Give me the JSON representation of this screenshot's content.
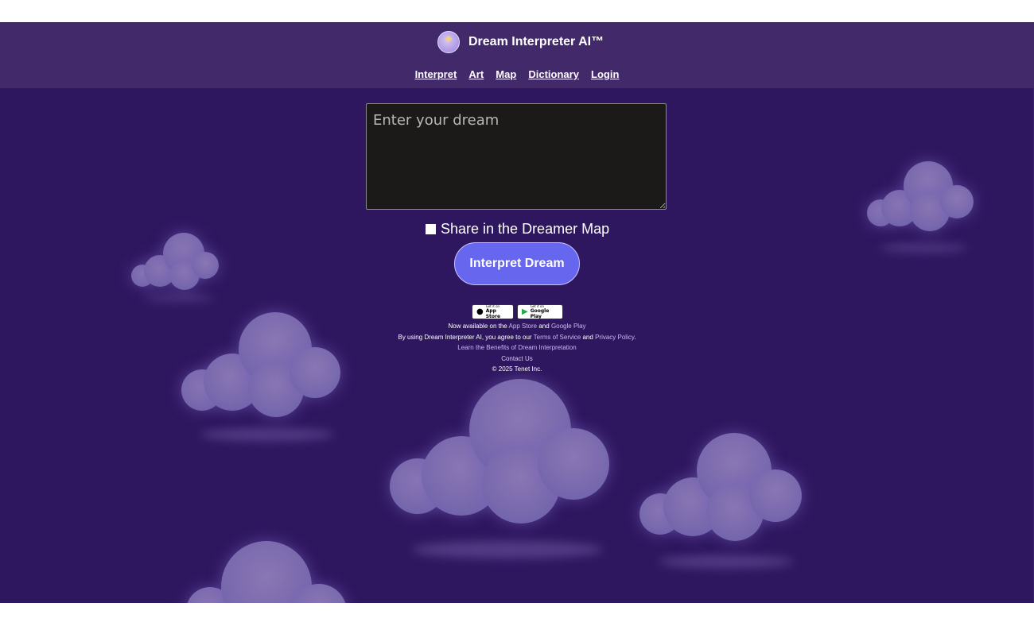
{
  "brand": {
    "name": "Dream Interpreter AI™"
  },
  "nav": [
    "Interpret",
    "Art",
    "Map",
    "Dictionary",
    "Login"
  ],
  "form": {
    "dream_placeholder": "Enter your dream",
    "share_label": "Share in the Dreamer Map",
    "share_checked": false,
    "submit_label": "Interpret Dream"
  },
  "stores": {
    "apple": {
      "small": "Get it on",
      "name": "App Store"
    },
    "google": {
      "small": "Get it on",
      "name": "Google Play"
    }
  },
  "footer": {
    "availability_prefix": "Now available on the",
    "availability_app_store": "App Store",
    "availability_and": "and",
    "availability_google_play": "Google Play",
    "terms_prefix": "By using Dream Interpreter AI, you agree to our",
    "terms_link": "Terms of Service",
    "terms_and": "and",
    "privacy_link": "Privacy Policy",
    "benefits_link": "Learn the Benefits of Dream Interpretation",
    "contact_link": "Contact Us",
    "copyright": "© 2025 Tenet Inc."
  },
  "colors": {
    "background": "#2f1760",
    "header": "#42296a",
    "button": "#6666ee",
    "cloud": "#7a6aae"
  }
}
